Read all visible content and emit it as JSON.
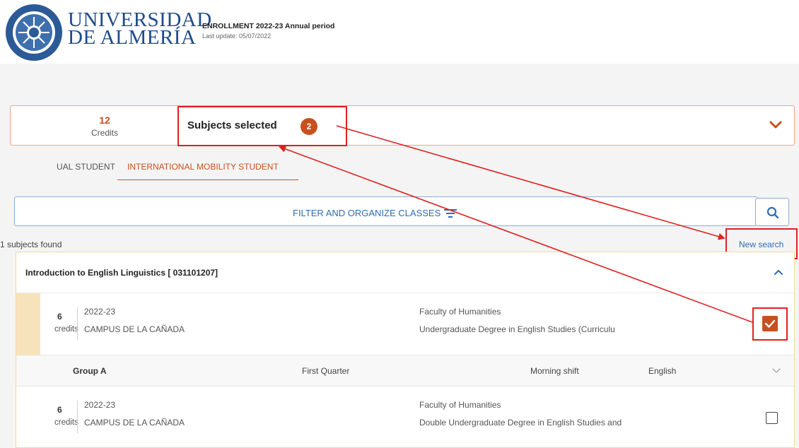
{
  "header": {
    "university_line1": "UNIVERSIDAD",
    "university_line2": "DE ALMERÍA",
    "enrollment_title": "ENROLLMENT 2022-23 Annual period",
    "last_update": "Last update:  05/07/2022"
  },
  "summary": {
    "credits_value": "12",
    "credits_label": "Credits",
    "subjects_label": "Subjects selected",
    "subjects_count": "2"
  },
  "tabs": [
    {
      "label": "UAL STUDENT",
      "active": false
    },
    {
      "label": "INTERNATIONAL MOBILITY STUDENT",
      "active": true
    }
  ],
  "filter": {
    "label": "FILTER AND ORGANIZE CLASSES",
    "icon": "filter-icon",
    "search_icon": "search-icon"
  },
  "results": {
    "found_text": "1 subjects found",
    "new_search": "New search"
  },
  "subject": {
    "title": "Introduction to English Linguistics [ 031101207]",
    "offers": [
      {
        "credits": "6",
        "credits_label": "credits",
        "year": "2022-23",
        "campus": "CAMPUS DE LA CAÑADA",
        "faculty": "Faculty of Humanities",
        "degree": "Undergraduate Degree in English Studies (Curriculu",
        "selected": true
      },
      {
        "credits": "6",
        "credits_label": "credits",
        "year": "2022-23",
        "campus": "CAMPUS DE LA CAÑADA",
        "faculty": "Faculty of Humanities",
        "degree": "Double Undergraduate Degree in English Studies and",
        "selected": false
      }
    ],
    "group": {
      "name": "Group A",
      "period": "First Quarter",
      "shift": "Morning shift",
      "language": "English"
    }
  },
  "colors": {
    "accent": "#c8501e",
    "link": "#2c6db4",
    "annotation": "#e02020",
    "card_border": "#f0d9a8"
  }
}
